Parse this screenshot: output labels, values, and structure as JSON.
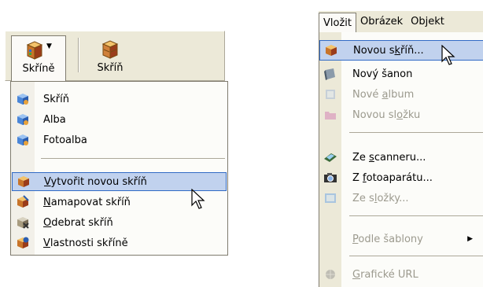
{
  "left": {
    "toolbar": {
      "skrine_label": "Skříně",
      "skrin_label": "Skříň",
      "skrine_icon": "cabinet-icon",
      "skrin_icon": "cabinet-icon",
      "arrow": "▼"
    },
    "dropdown": {
      "items": [
        {
          "label": "Skříň",
          "icon": "cabinet-blue-icon"
        },
        {
          "label": "Alba",
          "icon": "cabinet-blue-icon"
        },
        {
          "label": "Fotoalba",
          "icon": "cabinet-blue-icon"
        },
        {
          "pre": "",
          "u": "V",
          "post": "ytvořit novou skříň",
          "icon": "cabinet-icon",
          "highlighted": true
        },
        {
          "pre": "",
          "u": "N",
          "post": "amapovat skříň",
          "icon": "map-cabinet-icon"
        },
        {
          "pre": "",
          "u": "O",
          "post": "debrat skříň",
          "icon": "remove-cabinet-icon"
        },
        {
          "pre": "",
          "u": "V",
          "post": "lastnosti skříně",
          "icon": "properties-cabinet-icon"
        }
      ]
    }
  },
  "right": {
    "menubar": [
      "Vložit",
      "Obrázek",
      "Objekt"
    ],
    "menu": {
      "items": [
        {
          "pre": "Novou s",
          "u": "k",
          "post": "říň...",
          "icon": "cabinet-icon",
          "highlighted": true,
          "disabled": false
        },
        {
          "pre": "Nový šanon",
          "u": "",
          "post": "",
          "icon": "binder-icon",
          "disabled": false
        },
        {
          "pre": "Nové ",
          "u": "a",
          "post": "lbum",
          "icon": "album-icon",
          "disabled": true
        },
        {
          "pre": "Novou sl",
          "u": "o",
          "post": "žku",
          "icon": "folder-icon",
          "disabled": true
        },
        {
          "pre": "Ze ",
          "u": "s",
          "post": "canneru...",
          "icon": "scanner-icon",
          "disabled": false
        },
        {
          "pre": "Z ",
          "u": "f",
          "post": "otoaparátu...",
          "icon": "camera-icon",
          "disabled": false
        },
        {
          "pre": "Ze s",
          "u": "l",
          "post": "ožky...",
          "icon": "folder-image-icon",
          "disabled": true
        },
        {
          "pre": "",
          "u": "P",
          "post": "odle šablony",
          "icon": "",
          "disabled": true,
          "submenu": "▶"
        },
        {
          "pre": "",
          "u": "G",
          "post": "rafické URL",
          "icon": "url-icon",
          "disabled": true
        }
      ]
    }
  }
}
